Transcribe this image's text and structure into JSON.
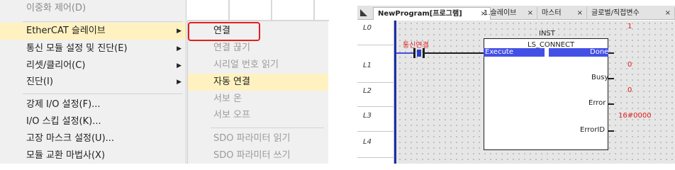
{
  "menu_main": {
    "items": [
      {
        "label": "이중화 제어(D)",
        "disabled": true
      },
      {
        "label": "EtherCAT 슬레이브",
        "submenu": true,
        "highlighted": true
      },
      {
        "label": "통신 모듈 설정 및 진단(E)",
        "submenu": true
      },
      {
        "label": "리셋/클리어(C)",
        "submenu": true
      },
      {
        "label": "진단(I)",
        "submenu": true
      },
      {
        "label": "강제 I/O 설정(F)..."
      },
      {
        "label": "I/O 스킵 설정(K)..."
      },
      {
        "label": "고장 마스크 설정(U)..."
      },
      {
        "label": "모듈 교환 마법사(X)"
      }
    ]
  },
  "menu_ethercat": {
    "items": [
      {
        "label": "연결",
        "highlighted": false,
        "outlined": true
      },
      {
        "label": "연결 끊기",
        "disabled": true
      },
      {
        "label": "시리얼 번호 읽기",
        "disabled": true
      },
      {
        "label": "자동 연결",
        "highlighted": true
      },
      {
        "label": "서보 온",
        "disabled": true
      },
      {
        "label": "서보 오프",
        "disabled": true
      },
      {
        "label": "SDO 파라미터 읽기",
        "disabled": true
      },
      {
        "label": "SDO 파라미터 쓰기",
        "disabled": true
      }
    ],
    "outline_color": "#e02020"
  },
  "editor": {
    "tabs": [
      {
        "label": "NewProgram[프로그램]",
        "active": true
      },
      {
        "label": "1.슬레이브"
      },
      {
        "label": "마스터"
      },
      {
        "label": "글로벌/직접변수"
      }
    ],
    "tab_close": "×",
    "rungs": [
      "L0",
      "L1",
      "L2",
      "L3",
      "L4"
    ],
    "contact_label": "통신연결",
    "fb": {
      "instance": "INST",
      "type": "LS_CONNECT",
      "input": "Execute",
      "outputs": [
        "Done",
        "Busy",
        "Error",
        "ErrorID"
      ]
    },
    "monitor_values": {
      "done": "1",
      "busy": "0",
      "error": "0",
      "error_id": "16#0000"
    },
    "colors": {
      "rail": "#1d2fa6",
      "active_wire": "#4350e6",
      "monitor_value": "#e02020"
    }
  }
}
